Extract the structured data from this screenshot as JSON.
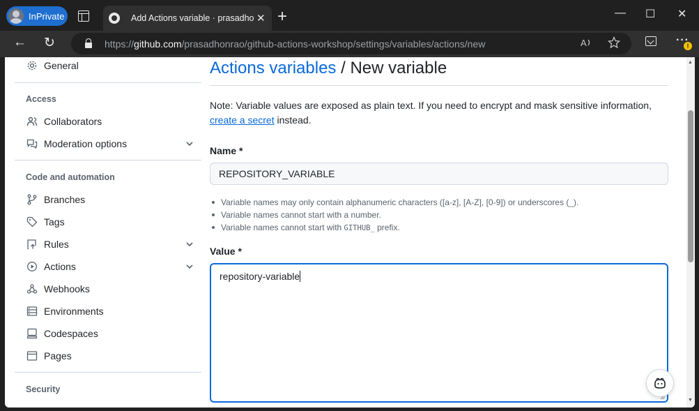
{
  "browser": {
    "profile_label": "InPrivate",
    "tab_title": "Add Actions variable · prasadhonrao",
    "tab_close": "✕",
    "new_tab": "+",
    "url_prefix": "https://",
    "url_host": "github.com",
    "url_path": "/prasadhonrao/github-actions-workshop/settings/variables/actions/new",
    "window_controls": {
      "minimize": "—",
      "maximize": "☐",
      "close": "✕"
    },
    "nav": {
      "back": "←",
      "refresh": "↻"
    },
    "warning_badge": "!"
  },
  "sidebar": {
    "general": {
      "label": "General",
      "icon": "gear-icon"
    },
    "access_heading": "Access",
    "access_items": [
      {
        "label": "Collaborators",
        "icon": "people-icon",
        "expandable": false
      },
      {
        "label": "Moderation options",
        "icon": "comment-discussion-icon",
        "expandable": true
      }
    ],
    "code_heading": "Code and automation",
    "code_items": [
      {
        "label": "Branches",
        "icon": "git-branch-icon",
        "expandable": false
      },
      {
        "label": "Tags",
        "icon": "tag-icon",
        "expandable": false
      },
      {
        "label": "Rules",
        "icon": "repo-push-icon",
        "expandable": true
      },
      {
        "label": "Actions",
        "icon": "play-icon",
        "expandable": true
      },
      {
        "label": "Webhooks",
        "icon": "webhook-icon",
        "expandable": false
      },
      {
        "label": "Environments",
        "icon": "server-icon",
        "expandable": false
      },
      {
        "label": "Codespaces",
        "icon": "codespaces-icon",
        "expandable": false
      },
      {
        "label": "Pages",
        "icon": "browser-icon",
        "expandable": false
      }
    ],
    "security_heading": "Security"
  },
  "main": {
    "breadcrumb_link": "Actions variables",
    "breadcrumb_sep": " / ",
    "breadcrumb_current": "New variable",
    "note_before": "Note: Variable values are exposed as plain text. If you need to encrypt and mask sensitive information, ",
    "note_link": "create a secret",
    "note_after": " instead.",
    "name_label": "Name *",
    "name_value": "REPOSITORY_VARIABLE",
    "hints": [
      {
        "text": "Variable names may only contain alphanumeric characters ([a-z], [A-Z], [0-9]) or underscores (_).",
        "code": "",
        "suffix": ""
      },
      {
        "text": "Variable names cannot start with a number.",
        "code": "",
        "suffix": ""
      },
      {
        "text": "Variable names cannot start with ",
        "code": "GITHUB_",
        "suffix": " prefix."
      }
    ],
    "value_label": "Value *",
    "value_text": "repository-variable"
  },
  "colors": {
    "link": "#0969da",
    "text": "#1f2328",
    "muted": "#59636e",
    "focus_border": "#0969da",
    "profile_pill": "#1e6fd0"
  }
}
